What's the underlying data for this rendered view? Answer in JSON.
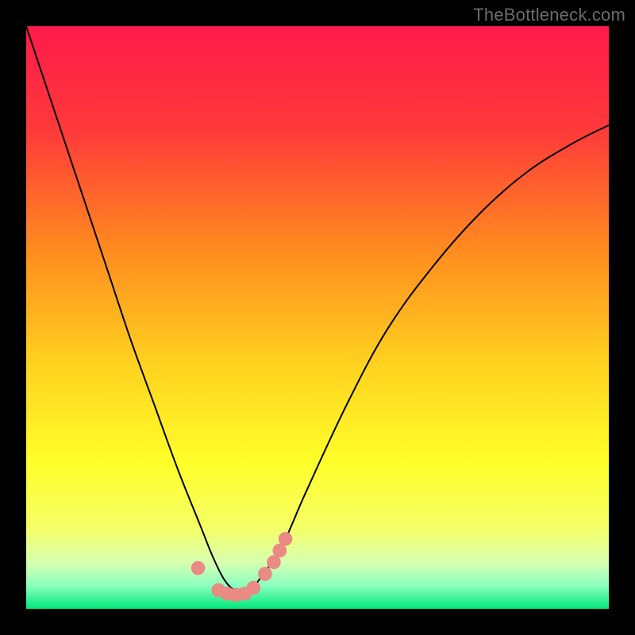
{
  "watermark": "TheBottleneck.com",
  "gradient": {
    "stops": [
      {
        "pct": 0,
        "color": "#ff1a4b"
      },
      {
        "pct": 18,
        "color": "#ff3a3a"
      },
      {
        "pct": 38,
        "color": "#ff8a1f"
      },
      {
        "pct": 58,
        "color": "#ffd21f"
      },
      {
        "pct": 75,
        "color": "#ffff2a"
      },
      {
        "pct": 86,
        "color": "#f5ff66"
      },
      {
        "pct": 92,
        "color": "#d8ffb0"
      },
      {
        "pct": 96,
        "color": "#8cffc0"
      },
      {
        "pct": 100,
        "color": "#00e87a"
      }
    ]
  },
  "chart_data": {
    "type": "line",
    "title": "",
    "xlabel": "",
    "ylabel": "",
    "xlim": [
      0,
      100
    ],
    "ylim": [
      0,
      100
    ],
    "series": [
      {
        "name": "bottleneck-curve",
        "x": [
          0,
          5,
          10,
          14,
          18,
          22,
          26,
          30,
          32,
          34,
          36,
          38,
          40,
          44,
          48,
          55,
          62,
          70,
          78,
          86,
          94,
          100
        ],
        "values": [
          100,
          85,
          70,
          58,
          46,
          35,
          24,
          14,
          9,
          5,
          3,
          3,
          5,
          11,
          20,
          35,
          48,
          59,
          68,
          75,
          80,
          83
        ]
      }
    ],
    "markers": {
      "name": "highlight-dots",
      "color": "#e98a84",
      "radius_pct": 1.2,
      "x": [
        29.5,
        33.0,
        34.5,
        36.0,
        37.5,
        39.0,
        41.0,
        42.5,
        43.5,
        44.5
      ],
      "values": [
        7.0,
        3.2,
        2.6,
        2.4,
        2.6,
        3.6,
        6.0,
        8.0,
        10.0,
        12.0
      ]
    }
  }
}
